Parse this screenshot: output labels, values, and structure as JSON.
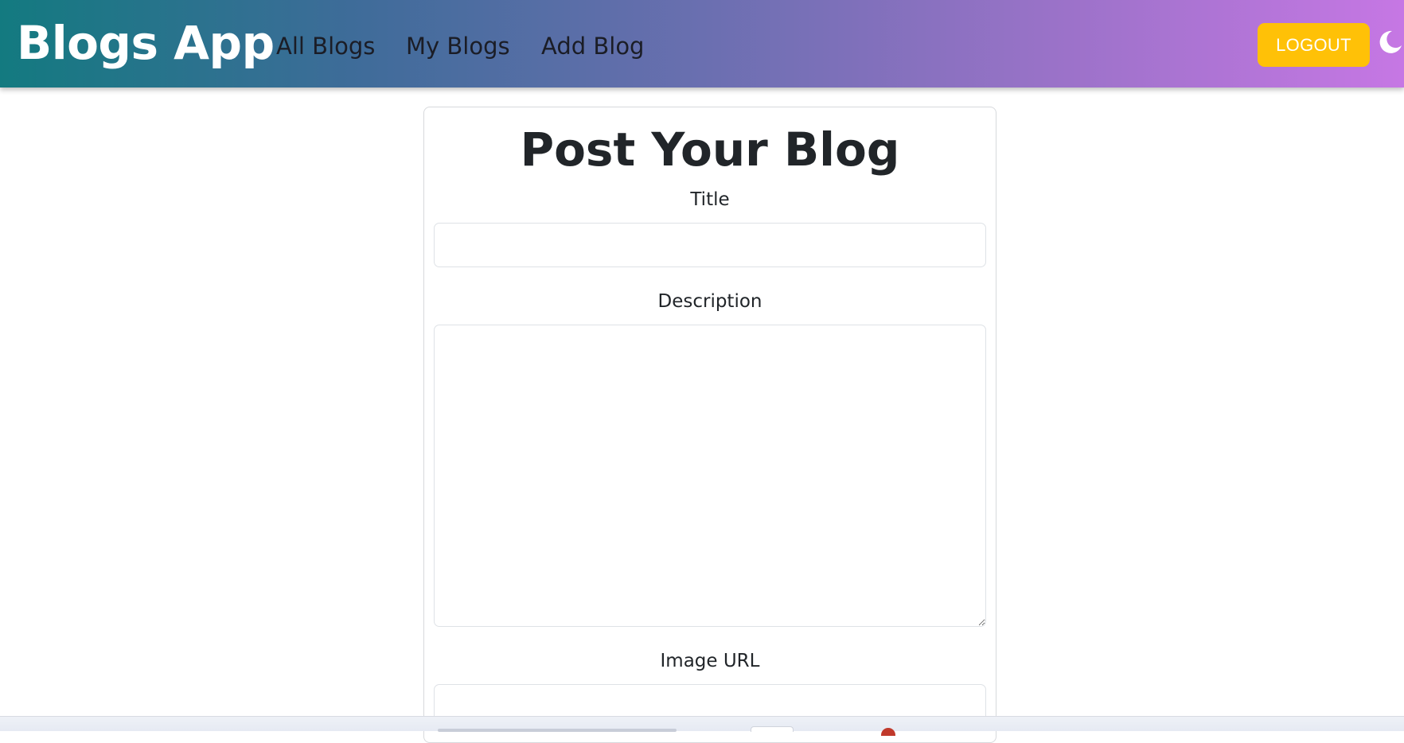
{
  "navbar": {
    "brand": "Blogs App",
    "links": [
      "All Blogs",
      "My Blogs",
      "Add Blog"
    ],
    "logout_label": "LOGOUT",
    "theme_toggle_icon": "moon-icon",
    "gradient_colors": [
      "#137a80",
      "#c677e4"
    ],
    "logout_color": "#ffc107"
  },
  "form": {
    "heading": "Post Your Blog",
    "title_label": "Title",
    "title_value": "",
    "description_label": "Description",
    "description_value": "",
    "image_label": "Image URL",
    "image_value": ""
  }
}
